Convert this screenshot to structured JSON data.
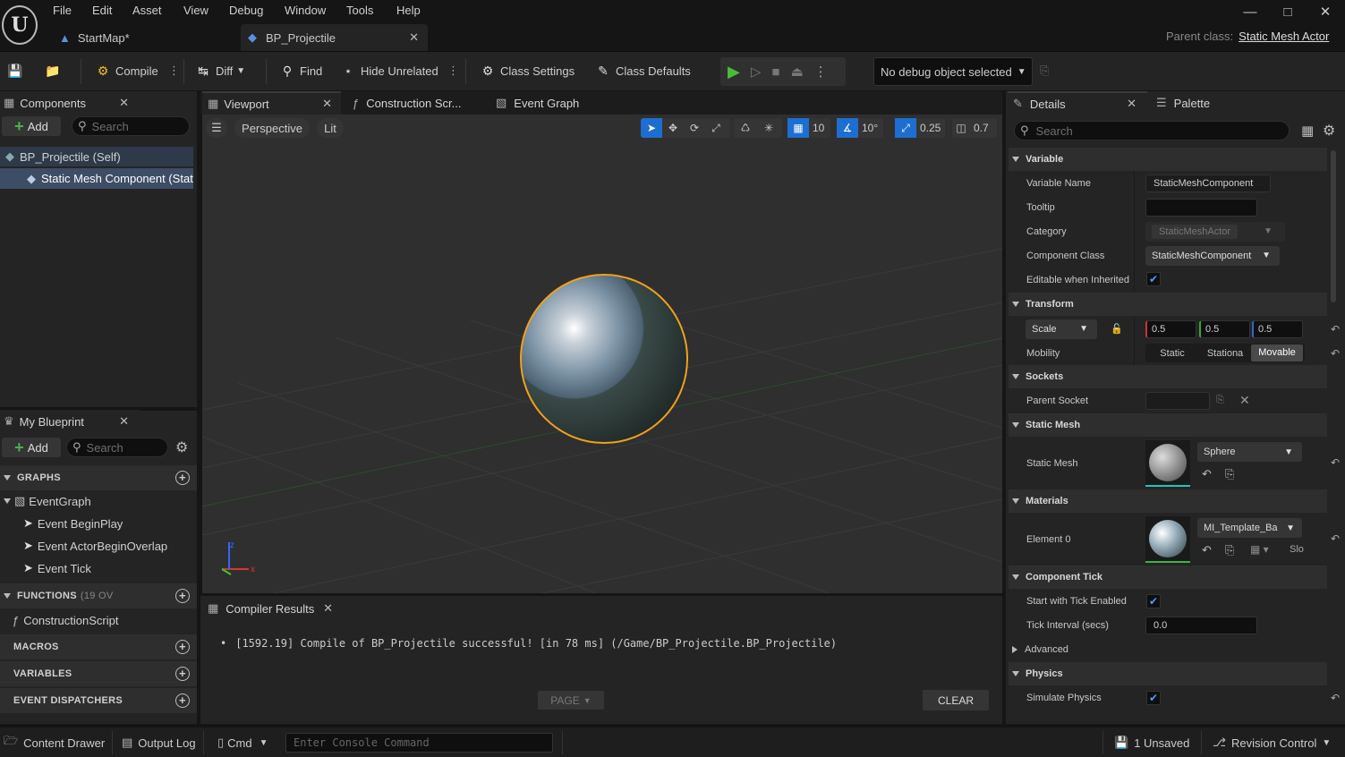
{
  "menu": [
    "File",
    "Edit",
    "Asset",
    "View",
    "Debug",
    "Window",
    "Tools",
    "Help"
  ],
  "tabs": {
    "startmap": "StartMap*",
    "bp": "BP_Projectile"
  },
  "parent_class": {
    "label": "Parent class:",
    "value": "Static Mesh Actor"
  },
  "toolbar": {
    "compile": "Compile",
    "diff": "Diff",
    "find": "Find",
    "hide_unrelated": "Hide Unrelated",
    "class_settings": "Class Settings",
    "class_defaults": "Class Defaults",
    "debug_object": "No debug object selected"
  },
  "components": {
    "title": "Components",
    "add": "Add",
    "search_placeholder": "Search",
    "items": [
      "BP_Projectile (Self)",
      "Static Mesh Component (Stat"
    ]
  },
  "my_blueprint": {
    "title": "My Blueprint",
    "add": "Add",
    "search_placeholder": "Search",
    "graphs": "GRAPHS",
    "event_graph": "EventGraph",
    "events": [
      "Event BeginPlay",
      "Event ActorBeginOverlap",
      "Event Tick"
    ],
    "functions": "FUNCTIONS",
    "functions_count": "(19 OV",
    "construction": "ConstructionScript",
    "macros": "MACROS",
    "variables": "VARIABLES",
    "dispatchers": "EVENT DISPATCHERS"
  },
  "editor_tabs": {
    "viewport": "Viewport",
    "construction": "Construction Scr...",
    "event_graph": "Event Graph"
  },
  "viewport": {
    "perspective": "Perspective",
    "lit": "Lit",
    "grid": "10",
    "rot": "10°",
    "scale": "0.25",
    "cam": "0.7"
  },
  "compiler": {
    "title": "Compiler Results",
    "message": "[1592.19] Compile of BP_Projectile successful! [in 78 ms] (/Game/BP_Projectile.BP_Projectile)",
    "page": "PAGE",
    "clear": "CLEAR"
  },
  "details": {
    "title": "Details",
    "palette": "Palette",
    "search_placeholder": "Search",
    "variable": {
      "header": "Variable",
      "name_label": "Variable Name",
      "name_value": "StaticMeshComponent",
      "tooltip_label": "Tooltip",
      "category_label": "Category",
      "category_value": "StaticMeshActor",
      "class_label": "Component Class",
      "class_value": "StaticMeshComponent",
      "editable_label": "Editable when Inherited"
    },
    "transform": {
      "header": "Transform",
      "scale": "Scale",
      "x": "0.5",
      "y": "0.5",
      "z": "0.5",
      "mobility_label": "Mobility",
      "mob": [
        "Static",
        "Stationa",
        "Movable"
      ]
    },
    "sockets": {
      "header": "Sockets",
      "parent_label": "Parent Socket"
    },
    "static_mesh": {
      "header": "Static Mesh",
      "label": "Static Mesh",
      "value": "Sphere"
    },
    "materials": {
      "header": "Materials",
      "label": "Element 0",
      "value": "MI_Template_Ba",
      "slot": "Slo"
    },
    "tick": {
      "header": "Component Tick",
      "start_label": "Start with Tick Enabled",
      "interval_label": "Tick Interval (secs)",
      "interval_value": "0.0",
      "advanced": "Advanced"
    },
    "physics": {
      "header": "Physics",
      "simulate_label": "Simulate Physics"
    }
  },
  "statusbar": {
    "content_drawer": "Content Drawer",
    "output_log": "Output Log",
    "cmd": "Cmd",
    "console_placeholder": "Enter Console Command",
    "unsaved": "1 Unsaved",
    "revision": "Revision Control"
  }
}
